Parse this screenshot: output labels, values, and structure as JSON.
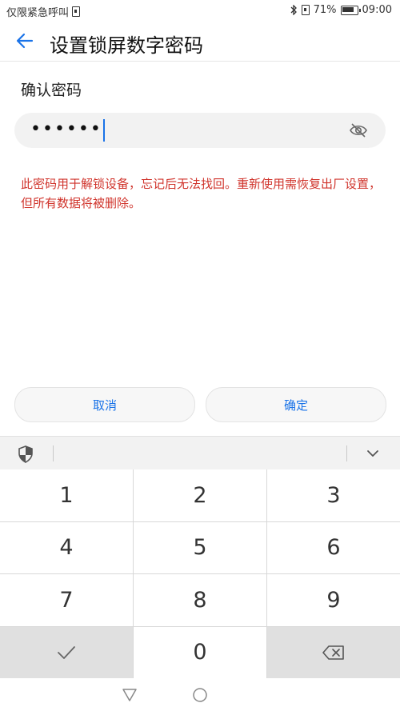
{
  "status_bar": {
    "carrier": "仅限紧急呼叫",
    "battery": "71%",
    "time": "09:00"
  },
  "header": {
    "title": "设置锁屏数字密码"
  },
  "form": {
    "label": "确认密码",
    "password_masked": "••••••"
  },
  "warning": "此密码用于解锁设备，忘记后无法找回。重新使用需恢复出厂设置，但所有数据将被删除。",
  "buttons": {
    "cancel": "取消",
    "confirm": "确定"
  },
  "keypad": {
    "keys": [
      "1",
      "2",
      "3",
      "4",
      "5",
      "6",
      "7",
      "8",
      "9",
      "0"
    ]
  },
  "icons": {
    "back": "back-arrow-icon",
    "eye": "eye-off-icon",
    "shield": "shield-icon",
    "collapse": "chevron-down-icon",
    "enter": "checkmark-icon",
    "delete": "backspace-icon",
    "nav_back": "nav-back-triangle-icon",
    "nav_home": "nav-home-circle-icon"
  },
  "colors": {
    "accent": "#1a73e8",
    "warning": "#d0342c",
    "field_bg": "#f2f2f2"
  }
}
